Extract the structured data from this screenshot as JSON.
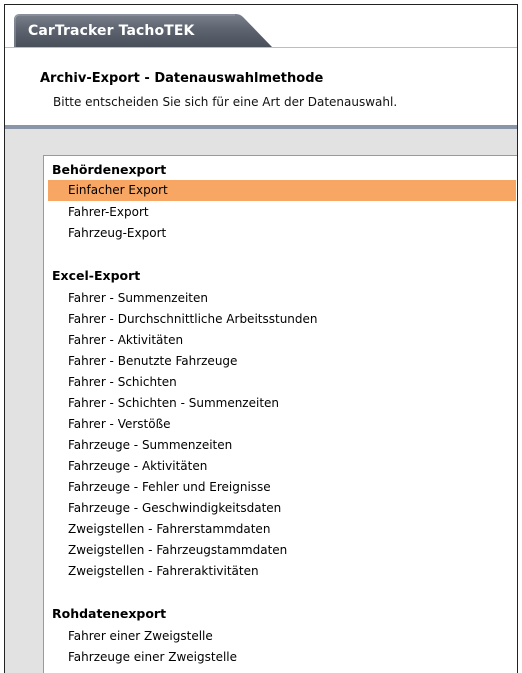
{
  "window": {
    "title": "CarTracker TachoTEK"
  },
  "header": {
    "title": "Archiv-Export - Datenauswahlmethode",
    "subtitle": "Bitte entscheiden Sie sich für eine Art der Datenauswahl."
  },
  "colors": {
    "tab_background": "#5e6470",
    "selection": "#f7a664",
    "separator": "#8a96a8"
  },
  "groups": [
    {
      "label": "Behördenexport",
      "items": [
        "Einfacher Export",
        "Fahrer-Export",
        "Fahrzeug-Export"
      ]
    },
    {
      "label": "Excel-Export",
      "items": [
        "Fahrer - Summenzeiten",
        "Fahrer - Durchschnittliche Arbeitsstunden",
        "Fahrer - Aktivitäten",
        "Fahrer - Benutzte Fahrzeuge",
        "Fahrer - Schichten",
        "Fahrer - Schichten - Summenzeiten",
        "Fahrer - Verstöße",
        "Fahrzeuge - Summenzeiten",
        "Fahrzeuge - Aktivitäten",
        "Fahrzeuge - Fehler und Ereignisse",
        "Fahrzeuge - Geschwindigkeitsdaten",
        "Zweigstellen - Fahrerstammdaten",
        "Zweigstellen - Fahrzeugstammdaten",
        "Zweigstellen - Fahreraktivitäten"
      ]
    },
    {
      "label": "Rohdatenexport",
      "items": [
        "Fahrer einer Zweigstelle",
        "Fahrzeuge einer Zweigstelle"
      ]
    }
  ],
  "selected_item": "Einfacher Export"
}
